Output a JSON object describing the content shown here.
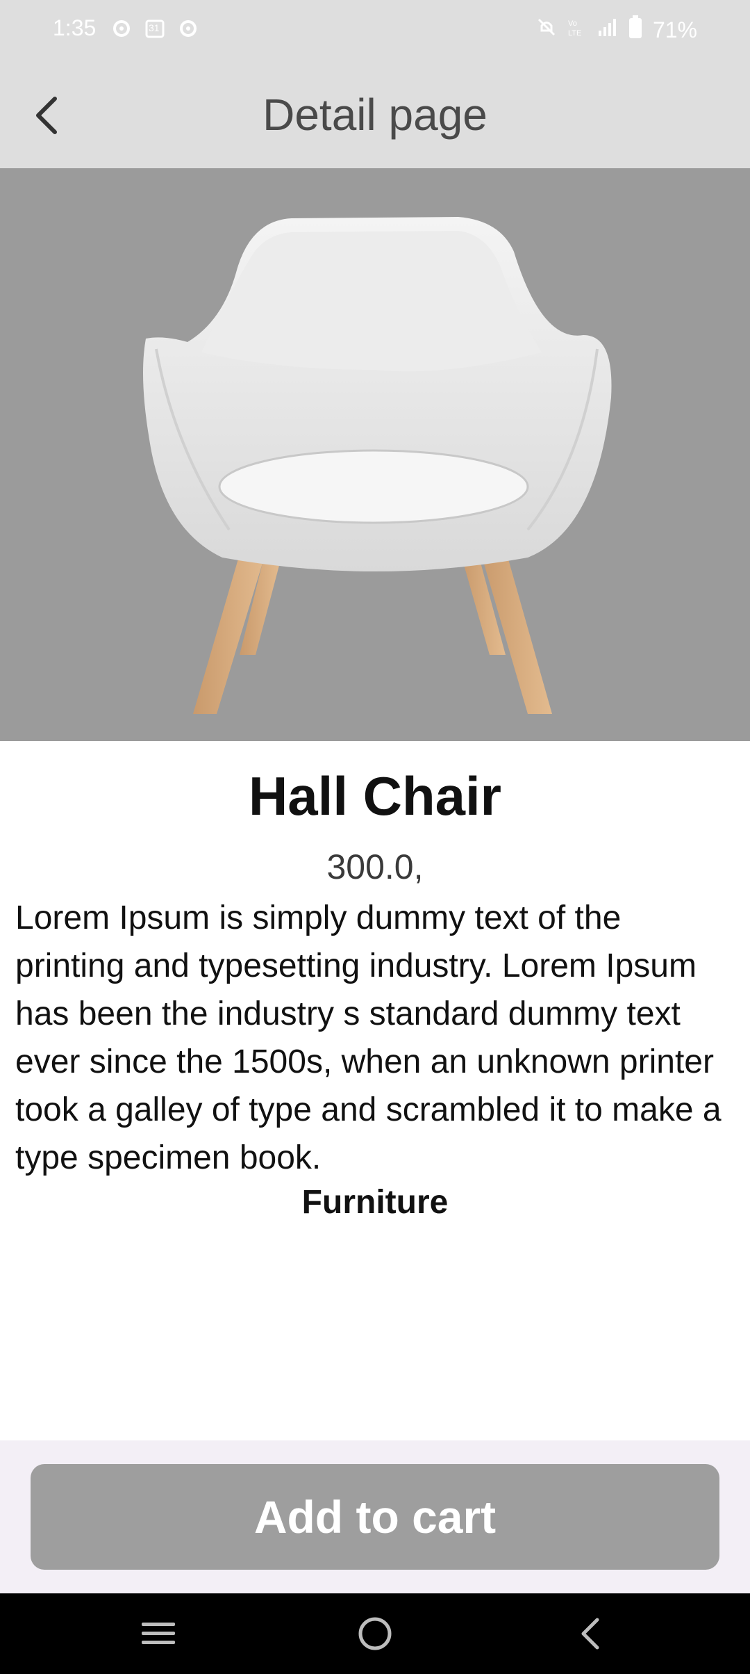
{
  "status_bar": {
    "time": "1:35",
    "left_icons": [
      "settings-gear-icon",
      "calendar-icon",
      "settings-gear-icon"
    ],
    "calendar_day": "31",
    "right_icons": [
      "mute-icon",
      "volte-icon",
      "signal-icon",
      "battery-icon"
    ],
    "battery": "71%"
  },
  "app_bar": {
    "title": "Detail page",
    "back_icon": "chevron-left-icon"
  },
  "product": {
    "image": "white-armchair-photo",
    "name": "Hall Chair",
    "price": "300.0,",
    "description": "Lorem Ipsum is simply dummy text of the printing and typesetting industry. Lorem Ipsum has been the industry s standard dummy text ever since the 1500s, when an unknown printer took a galley of type and scrambled it to make a type specimen book.",
    "category": "Furniture"
  },
  "actions": {
    "add_to_cart_label": "Add to cart"
  },
  "navigation_bar": {
    "items": [
      "recent-apps-icon",
      "home-icon",
      "back-icon"
    ]
  },
  "colors": {
    "app_bar_bg": "#dedede",
    "hero_bg": "#9b9b9b",
    "button_bg": "#9e9e9e",
    "bottom_panel_bg": "#f3eff6"
  }
}
